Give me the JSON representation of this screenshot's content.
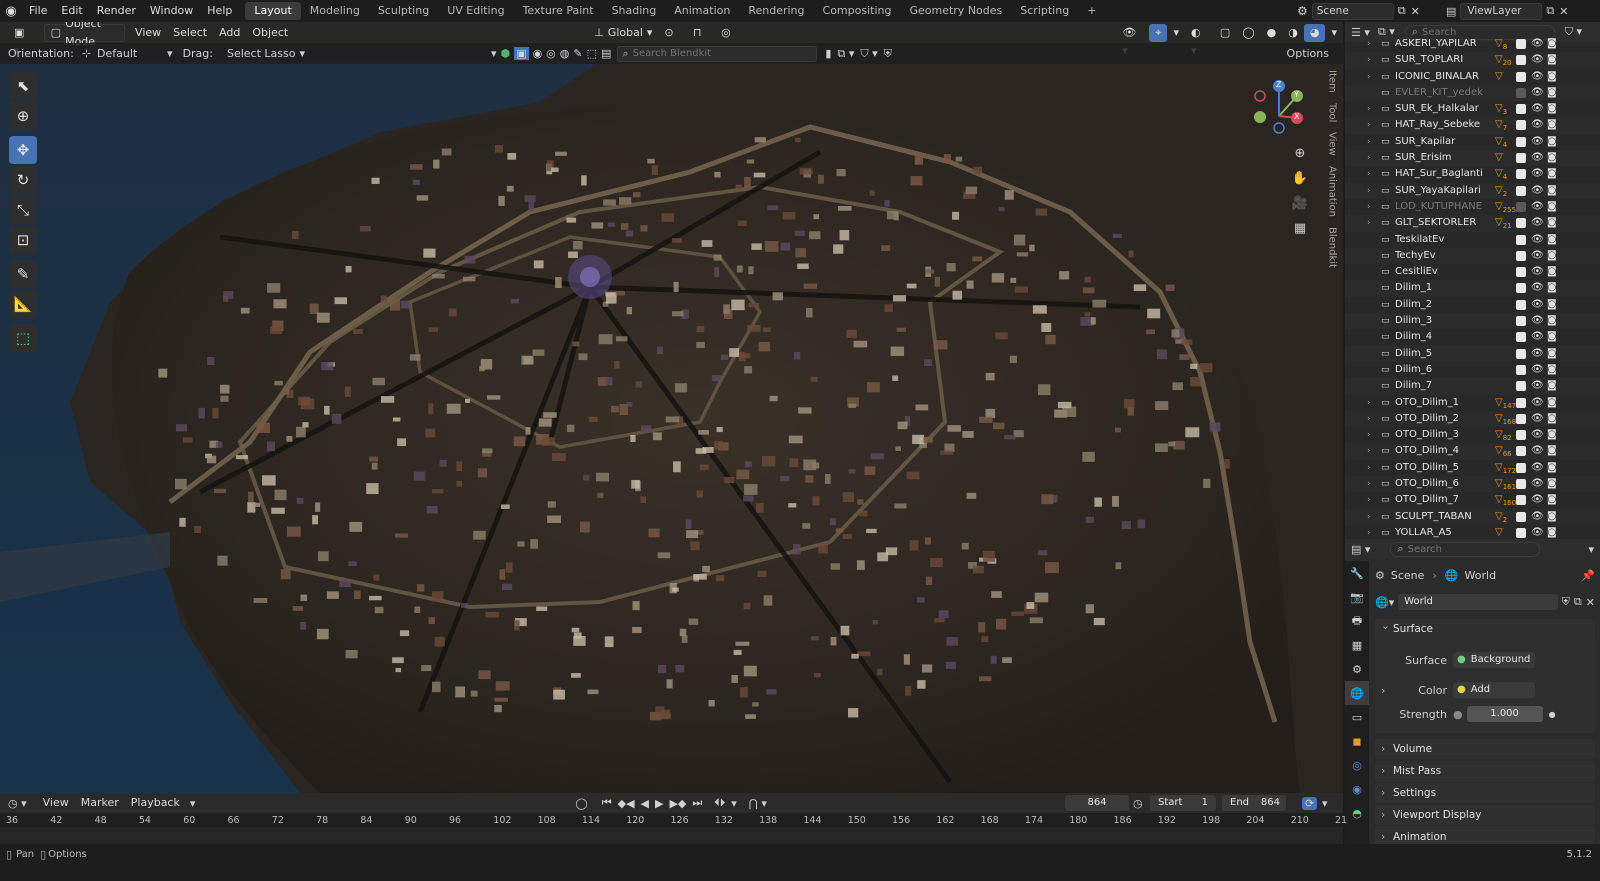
{
  "topbar": {
    "menus": [
      "File",
      "Edit",
      "Render",
      "Window",
      "Help"
    ],
    "workspaces": [
      "Layout",
      "Modeling",
      "Sculpting",
      "UV Editing",
      "Texture Paint",
      "Shading",
      "Animation",
      "Rendering",
      "Compositing",
      "Geometry Nodes",
      "Scripting"
    ],
    "active_workspace": "Layout",
    "add_tab": "+",
    "scene": "Scene",
    "view_layer": "ViewLayer"
  },
  "viewport": {
    "mode": "Object Mode",
    "menus": [
      "View",
      "Select",
      "Add",
      "Object"
    ],
    "transform_orientation": "Global",
    "orientation_label": "Orientation:",
    "orientation_value": "Default",
    "drag_label": "Drag:",
    "drag_value": "Select Lasso",
    "search_placeholder": "Search Blendkit",
    "options": "Options",
    "side_tabs": [
      "Item",
      "Tool",
      "View",
      "Animation",
      "Blendkit"
    ],
    "gizmo": {
      "x": "X",
      "y": "Y",
      "z": "Z"
    }
  },
  "outliner": {
    "search_placeholder": "Search",
    "rows": [
      {
        "name": "ASKERI_YAPILAR",
        "expand": true,
        "badge": "8",
        "dim": false
      },
      {
        "name": "SUR_TOPLARI",
        "expand": true,
        "badge": "20",
        "dim": false
      },
      {
        "name": "ICONIC_BINALAR",
        "expand": true,
        "badge": "",
        "dim": false
      },
      {
        "name": "EVLER_KIT_yedek",
        "expand": false,
        "badge": "",
        "dim": true
      },
      {
        "name": "SUR_Ek_Halkalar",
        "expand": true,
        "badge": "3",
        "dim": false
      },
      {
        "name": "HAT_Ray_Sebeke",
        "expand": true,
        "badge": "7",
        "dim": false
      },
      {
        "name": "SUR_Kapilar",
        "expand": true,
        "badge": "4",
        "dim": false
      },
      {
        "name": "SUR_Erisim",
        "expand": true,
        "badge": "",
        "dim": false
      },
      {
        "name": "HAT_Sur_Baglanti",
        "expand": true,
        "badge": "4",
        "dim": false
      },
      {
        "name": "SUR_YayaKapilari",
        "expand": true,
        "badge": "2",
        "dim": false
      },
      {
        "name": "LOD_KUTUPHANE",
        "expand": true,
        "badge": "255",
        "dim": true
      },
      {
        "name": "GLT_SEKTORLER",
        "expand": true,
        "badge": "21",
        "dim": false
      },
      {
        "name": "TeskilatEv",
        "expand": false,
        "badge": "",
        "dim": false
      },
      {
        "name": "TechyEv",
        "expand": false,
        "badge": "",
        "dim": false
      },
      {
        "name": "CesitliEv",
        "expand": false,
        "badge": "",
        "dim": false
      },
      {
        "name": "Dilim_1",
        "expand": false,
        "badge": "",
        "dim": false
      },
      {
        "name": "Dilim_2",
        "expand": false,
        "badge": "",
        "dim": false
      },
      {
        "name": "Dilim_3",
        "expand": false,
        "badge": "",
        "dim": false
      },
      {
        "name": "Dilim_4",
        "expand": false,
        "badge": "",
        "dim": false
      },
      {
        "name": "Dilim_5",
        "expand": false,
        "badge": "",
        "dim": false
      },
      {
        "name": "Dilim_6",
        "expand": false,
        "badge": "",
        "dim": false
      },
      {
        "name": "Dilim_7",
        "expand": false,
        "badge": "",
        "dim": false
      },
      {
        "name": "OTO_Dilim_1",
        "expand": true,
        "badge": "147",
        "dim": false
      },
      {
        "name": "OTO_Dilim_2",
        "expand": true,
        "badge": "168",
        "dim": false
      },
      {
        "name": "OTO_Dilim_3",
        "expand": true,
        "badge": "82",
        "dim": false
      },
      {
        "name": "OTO_Dilim_4",
        "expand": true,
        "badge": "66",
        "dim": false
      },
      {
        "name": "OTO_Dilim_5",
        "expand": true,
        "badge": "172",
        "dim": false
      },
      {
        "name": "OTO_Dilim_6",
        "expand": true,
        "badge": "161",
        "dim": false
      },
      {
        "name": "OTO_Dilim_7",
        "expand": true,
        "badge": "160",
        "dim": false
      },
      {
        "name": "SCULPT_TABAN",
        "expand": true,
        "badge": "2",
        "dim": false
      },
      {
        "name": "YOLLAR_A5",
        "expand": true,
        "badge": "",
        "dim": false
      }
    ]
  },
  "properties": {
    "search_placeholder": "Search",
    "breadcrumb_scene": "Scene",
    "breadcrumb_world": "World",
    "world_name": "World",
    "surface_panel": "Surface",
    "surface_label": "Surface",
    "surface_value": "Background",
    "color_label": "Color",
    "color_value": "Add",
    "strength_label": "Strength",
    "strength_value": "1.000",
    "panels": [
      "Volume",
      "Mist Pass",
      "Settings",
      "Viewport Display",
      "Animation"
    ]
  },
  "timeline": {
    "menus": [
      "View",
      "Marker",
      "Playback"
    ],
    "current_frame": "864",
    "start_label": "Start",
    "start_value": "1",
    "end_label": "End",
    "end_value": "864",
    "ticks": [
      "36",
      "42",
      "48",
      "54",
      "60",
      "66",
      "72",
      "78",
      "84",
      "90",
      "96",
      "102",
      "108",
      "114",
      "120",
      "126",
      "132",
      "138",
      "144",
      "150",
      "156",
      "162",
      "168",
      "174",
      "180",
      "186",
      "192",
      "198",
      "204",
      "210",
      "21"
    ]
  },
  "statusbar": {
    "pan": "Pan",
    "options": "Options",
    "version": "5.1.2"
  },
  "colors": {
    "accent": "#4772b3",
    "collection_filter": "#e79a2e",
    "background": "#1d1d1d"
  }
}
